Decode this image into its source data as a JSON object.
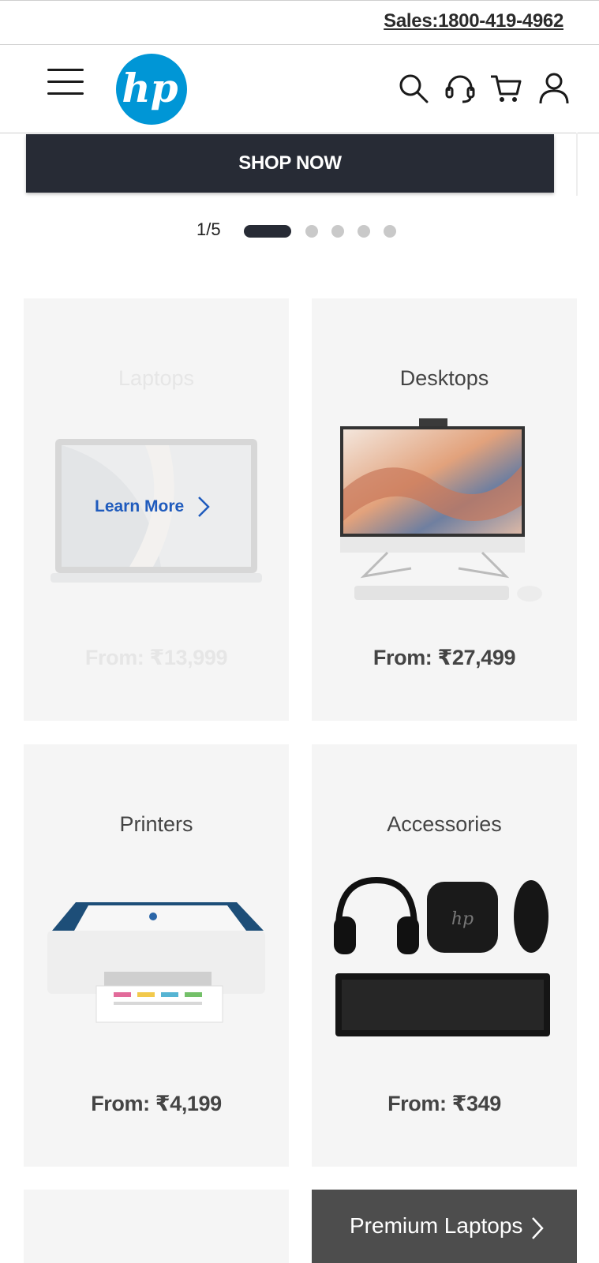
{
  "topbar": {
    "sales_text": "Sales:1800-419-4962"
  },
  "header": {
    "logo_text": "hp",
    "brand_color": "#0096d6",
    "icons": [
      "menu-icon",
      "search-icon",
      "support-headset-icon",
      "cart-icon",
      "account-icon"
    ]
  },
  "hero": {
    "cta_label": "SHOP NOW",
    "pager": {
      "label": "1/5",
      "current": 1,
      "total": 5
    }
  },
  "categories": [
    {
      "title": "Laptops",
      "price": "From: ₹13,999",
      "faded": true,
      "overlay_label": "Learn More"
    },
    {
      "title": "Desktops",
      "price": "From: ₹27,499"
    },
    {
      "title": "Printers",
      "price": "From: ₹4,199"
    },
    {
      "title": "Accessories",
      "price": "From: ₹349"
    }
  ],
  "bottom_tiles": {
    "premium_label": "Premium Laptops"
  },
  "colors": {
    "dark": "#272b35",
    "card_bg": "#f5f5f5",
    "link_blue": "#1f5bbd",
    "tile_dark": "#4d4d4d"
  }
}
